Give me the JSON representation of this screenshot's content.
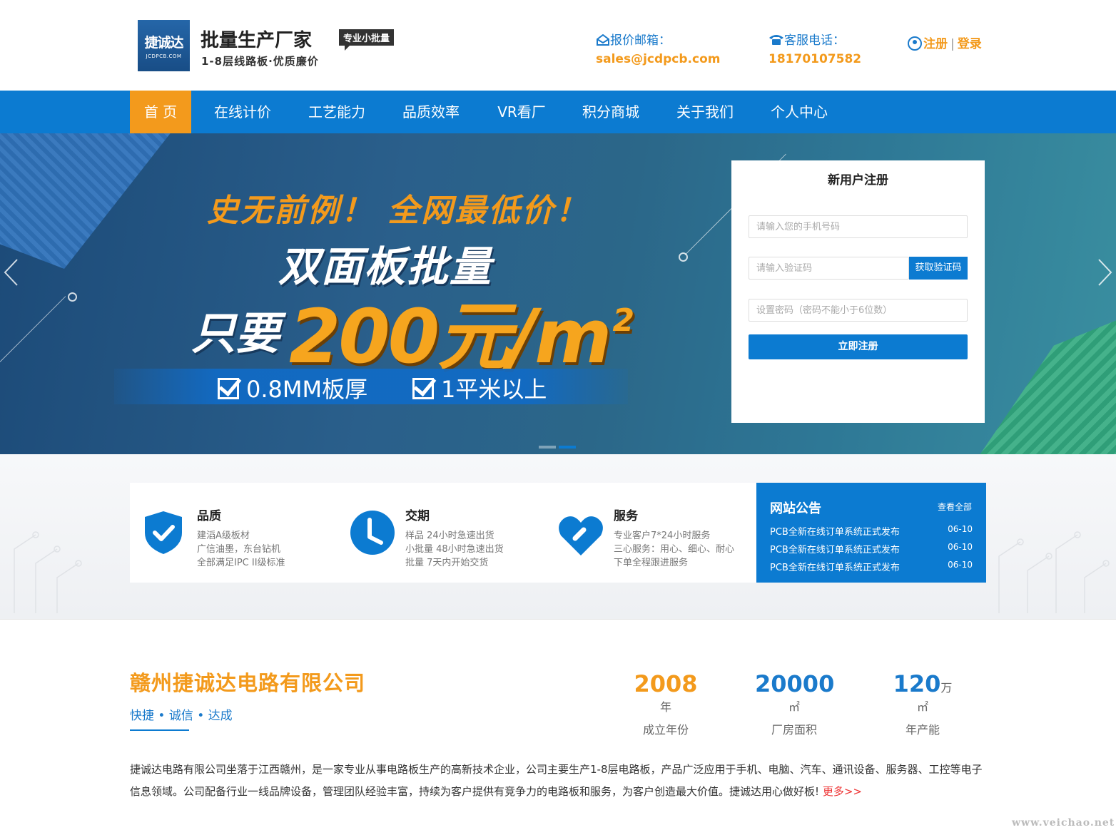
{
  "header": {
    "logo_text": "捷诚达",
    "logo_sub": "JCDPCB.COM",
    "brand_title": "批量生产厂家",
    "brand_tag": "专业小批量",
    "brand_sub": "1-8层线路板·优质廉价",
    "email_label": "报价邮箱：",
    "email_value": "sales@jcdpcb.com",
    "phone_label": "客服电话：",
    "phone_value": "18170107582",
    "register_label": "注册",
    "separator": "|",
    "login_label": "登录",
    "icons": [
      "mail-icon",
      "phone-icon",
      "user-icon"
    ]
  },
  "nav": {
    "items": [
      {
        "label": "首 页",
        "active": true
      },
      {
        "label": "在线计价"
      },
      {
        "label": "工艺能力"
      },
      {
        "label": "品质效率"
      },
      {
        "label": "VR看厂"
      },
      {
        "label": "积分商城"
      },
      {
        "label": "关于我们"
      },
      {
        "label": "个人中心"
      }
    ]
  },
  "banner": {
    "headline1": "史无前例！  全网最低价！",
    "headline2": "双面板批量",
    "headline3": "只要",
    "price": "200元/m",
    "price_sup": "2",
    "feature1": "0.8MM板厚",
    "feature2": "1平米以上",
    "slide_count": 2,
    "active_slide": 2
  },
  "register": {
    "title": "新用户注册",
    "phone_placeholder": "请输入您的手机号码",
    "code_placeholder": "请输入验证码",
    "code_button": "获取验证码",
    "password_placeholder": "设置密码（密码不能小于6位数）",
    "submit_label": "立即注册"
  },
  "features": [
    {
      "title": "品质",
      "icon": "shield-check-icon",
      "lines": [
        "建滔A级板材",
        "广信油墨，东台钻机",
        "全部满足IPC II级标准"
      ]
    },
    {
      "title": "交期",
      "icon": "clock-icon",
      "lines": [
        "样品 24小时急速出货",
        "小批量 48小时急速出货",
        "批量 7天内开始交货"
      ]
    },
    {
      "title": "服务",
      "icon": "heart-icon",
      "lines": [
        "专业客户7*24小时服务",
        "三心服务：用心、细心、耐心",
        "下单全程跟进服务"
      ]
    }
  ],
  "notice": {
    "title": "网站公告",
    "more_label": "查看全部",
    "items": [
      {
        "text": "PCB全新在线订单系统正式发布",
        "date": "06-10"
      },
      {
        "text": "PCB全新在线订单系统正式发布",
        "date": "06-10"
      },
      {
        "text": "PCB全新在线订单系统正式发布",
        "date": "06-10"
      }
    ]
  },
  "company": {
    "name": "赣州捷诚达电路有限公司",
    "slogan": "快捷 • 诚信 • 达成",
    "stats": [
      {
        "num": "2008",
        "unit": "年",
        "label": "成立年份",
        "color": "#f39a1c"
      },
      {
        "num": "20000",
        "unit": "㎡",
        "label": "厂房面积",
        "color": "#1a7acb"
      },
      {
        "num": "120",
        "unit": "万㎡",
        "label": "年产能",
        "color": "#1a7acb"
      }
    ],
    "description": "捷诚达电路有限公司坐落于江西赣州，是一家专业从事电路板生产的高新技术企业，公司主要生产1-8层电路板，产品广泛应用于手机、电脑、汽车、通讯设备、服务器、工控等电子信息领域。公司配备行业一线品牌设备，管理团队经验丰富，持续为客户提供有竞争力的电路板和服务，为客户创造最大价值。捷诚达用心做好板!",
    "more_label": "更多>>"
  },
  "watermark": "www.veichao.net",
  "colors": {
    "primary": "#0c7bd1",
    "accent": "#f39a1c"
  }
}
